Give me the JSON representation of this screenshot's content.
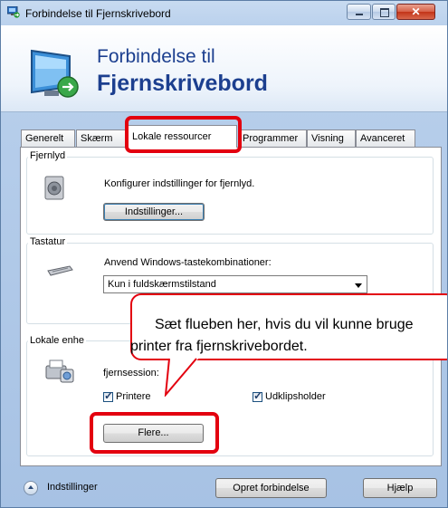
{
  "window": {
    "title": "Forbindelse til Fjernskrivebord",
    "header_line1": "Forbindelse til",
    "header_line2": "Fjernskrivebord"
  },
  "tabs": [
    {
      "label": "Generelt"
    },
    {
      "label": "Skærm"
    },
    {
      "label": "Lokale ressourcer"
    },
    {
      "label": "Programmer"
    },
    {
      "label": "Visning"
    },
    {
      "label": "Avanceret"
    }
  ],
  "active_tab": "Lokale ressourcer",
  "groups": {
    "fjernlyd": {
      "label": "Fjernlyd",
      "text": "Konfigurer indstillinger for fjernlyd.",
      "button": "Indstillinger..."
    },
    "tastatur": {
      "label": "Tastatur",
      "text": "Anvend Windows-tastekombinationer:",
      "combo_value": "Kun i fuldskærmstilstand"
    },
    "lokale_enheder": {
      "label": "Lokale enhe",
      "text": "fjernsession:",
      "cb_printere": "Printere",
      "cb_udklip": "Udklipsholder",
      "button": "Flere..."
    }
  },
  "callout": {
    "line1": "Sæt flueben her, hvis du vil kunne bruge",
    "line2": "printer fra fjernskrivebordet."
  },
  "footer": {
    "options_label": "Indstillinger",
    "connect_button": "Opret forbindelse",
    "help_button": "Hjælp"
  },
  "colors": {
    "highlight": "#e3000f",
    "header_text": "#1c3f8f"
  }
}
